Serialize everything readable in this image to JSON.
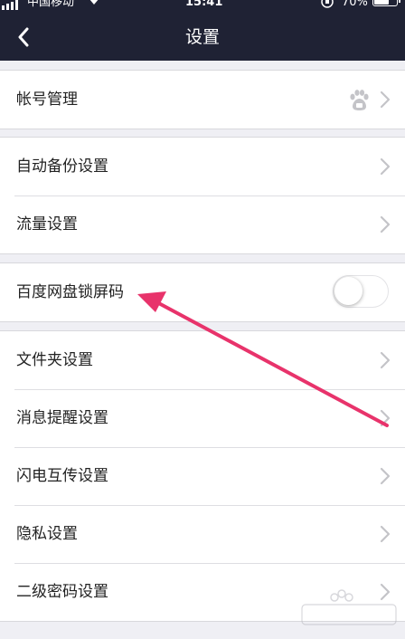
{
  "status_bar": {
    "carrier": "中国移动",
    "time": "15:41",
    "battery_percent": "70%",
    "battery_level": 0.7
  },
  "header": {
    "title": "设置",
    "back_icon": "chevron-left-icon"
  },
  "groups": [
    {
      "items": [
        {
          "label": "帐号管理",
          "accessory": "baidu-paw-icon"
        }
      ]
    },
    {
      "items": [
        {
          "label": "自动备份设置"
        },
        {
          "label": "流量设置"
        }
      ]
    },
    {
      "items": [
        {
          "label": "百度网盘锁屏码",
          "toggle": false
        }
      ]
    },
    {
      "items": [
        {
          "label": "文件夹设置"
        },
        {
          "label": "消息提醒设置"
        },
        {
          "label": "闪电互传设置"
        },
        {
          "label": "隐私设置"
        },
        {
          "label": "二级密码设置"
        }
      ]
    }
  ],
  "annotation": {
    "arrow_color": "#e8336b"
  },
  "watermark": {
    "text": "Bai 经验"
  },
  "colors": {
    "header_bg": "#1f2234",
    "page_bg": "#efeff4"
  }
}
